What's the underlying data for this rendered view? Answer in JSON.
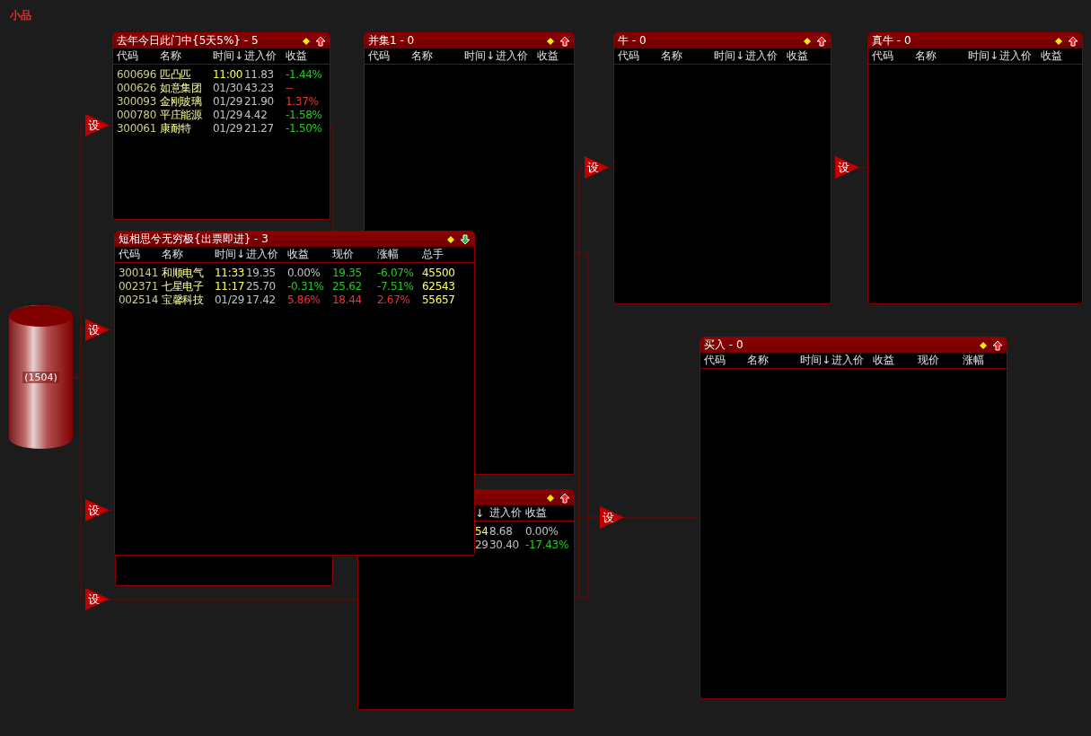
{
  "app_title": "小品",
  "source": {
    "label": "(1504)"
  },
  "set_buttons": [
    {
      "label": "设"
    },
    {
      "label": "设"
    },
    {
      "label": "设"
    },
    {
      "label": "设"
    },
    {
      "label": "设"
    },
    {
      "label": "设"
    },
    {
      "label": "设"
    }
  ],
  "windows": [
    {
      "kind": "list",
      "title": "去年今日此门中{5天5%} - 5",
      "sort_up": true,
      "columns": [
        "代码",
        "名称",
        "时间↓",
        "进入价",
        "收益"
      ],
      "rows": [
        [
          {
            "text": "600696",
            "color": "#cccc88"
          },
          {
            "text": "匹凸匹"
          },
          {
            "text": "11:00",
            "color": "#ffff55"
          },
          {
            "text": "11.83",
            "color": "#c0c0c0"
          },
          {
            "text": "-1.44%",
            "color": "#22cc22"
          }
        ],
        [
          {
            "text": "000626",
            "color": "#cccc88"
          },
          {
            "text": "如意集团"
          },
          {
            "text": "01/30",
            "color": "#c0c0c0"
          },
          {
            "text": "43.23",
            "color": "#c0c0c0"
          },
          {
            "text": "--",
            "color": "#ee3333"
          }
        ],
        [
          {
            "text": "300093",
            "color": "#cccc88"
          },
          {
            "text": "金刚玻璃"
          },
          {
            "text": "01/29",
            "color": "#c0c0c0"
          },
          {
            "text": "21.90",
            "color": "#c0c0c0"
          },
          {
            "text": "1.37%",
            "color": "#ee3333"
          }
        ],
        [
          {
            "text": "000780",
            "color": "#cccc88"
          },
          {
            "text": "平庄能源"
          },
          {
            "text": "01/29",
            "color": "#c0c0c0"
          },
          {
            "text": "4.42",
            "color": "#c0c0c0"
          },
          {
            "text": "-1.58%",
            "color": "#22cc22"
          }
        ],
        [
          {
            "text": "300061",
            "color": "#cccc88"
          },
          {
            "text": "康耐特"
          },
          {
            "text": "01/29",
            "color": "#c0c0c0"
          },
          {
            "text": "21.27",
            "color": "#c0c0c0"
          },
          {
            "text": "-1.50%",
            "color": "#22cc22"
          }
        ]
      ]
    },
    {
      "kind": "list",
      "title": "并集1 - 0",
      "sort_up": true,
      "columns": [
        "代码",
        "名称",
        "时间↓",
        "进入价",
        "收益"
      ]
    },
    {
      "kind": "list",
      "title": "牛 - 0",
      "sort_up": true,
      "columns": [
        "代码",
        "名称",
        "时间↓",
        "进入价",
        "收益"
      ]
    },
    {
      "kind": "list",
      "title": "真牛 - 0",
      "sort_up": true,
      "columns": [
        "代码",
        "名称",
        "时间↓",
        "进入价",
        "收益"
      ]
    },
    {
      "kind": "frame"
    },
    {
      "kind": "partial",
      "sort_up": true,
      "columns": [
        "↓",
        "进入价",
        "收益"
      ],
      "rows": [
        [
          {
            "text": "54",
            "color": "#ffff55"
          },
          {
            "text": "8.68",
            "color": "#c0c0c0"
          },
          {
            "text": "0.00%",
            "color": "#c0c0c0"
          }
        ],
        [
          {
            "text": "29",
            "color": "#c0c0c0"
          },
          {
            "text": "30.40",
            "color": "#c0c0c0"
          },
          {
            "text": "-17.43%",
            "color": "#22cc22"
          }
        ]
      ]
    },
    {
      "kind": "list",
      "title": "买入 - 0",
      "sort_up": true,
      "columns": [
        "代码",
        "名称",
        "时间↓",
        "进入价",
        "收益",
        "现价",
        "涨幅"
      ]
    },
    {
      "kind": "list",
      "title": "短相思兮无穷极{出票即进} - 3",
      "sort_up": false,
      "columns": [
        "代码",
        "名称",
        "时间↓",
        "进入价",
        "收益",
        "现价",
        "涨幅",
        "总手"
      ],
      "rows": [
        [
          {
            "text": "300141",
            "color": "#cccc88"
          },
          {
            "text": "和顺电气"
          },
          {
            "text": "11:33",
            "color": "#ffff55"
          },
          {
            "text": "19.35",
            "color": "#c0c0c0"
          },
          {
            "text": "0.00%",
            "color": "#c0c0c0"
          },
          {
            "text": "19.35",
            "color": "#22cc22"
          },
          {
            "text": "-6.07%",
            "color": "#22cc22"
          },
          {
            "text": "45500",
            "color": "#ffff66"
          }
        ],
        [
          {
            "text": "002371",
            "color": "#cccc88"
          },
          {
            "text": "七星电子"
          },
          {
            "text": "11:17",
            "color": "#ffff55"
          },
          {
            "text": "25.70",
            "color": "#c0c0c0"
          },
          {
            "text": "-0.31%",
            "color": "#22cc22"
          },
          {
            "text": "25.62",
            "color": "#22cc22"
          },
          {
            "text": "-7.51%",
            "color": "#22cc22"
          },
          {
            "text": "62543",
            "color": "#ffff66"
          }
        ],
        [
          {
            "text": "002514",
            "color": "#cccc88"
          },
          {
            "text": "宝馨科技"
          },
          {
            "text": "01/29",
            "color": "#c0c0c0"
          },
          {
            "text": "17.42",
            "color": "#c0c0c0"
          },
          {
            "text": "5.86%",
            "color": "#ee3333"
          },
          {
            "text": "18.44",
            "color": "#ee3333"
          },
          {
            "text": "2.67%",
            "color": "#ee3333"
          },
          {
            "text": "55657",
            "color": "#ffff66"
          }
        ]
      ]
    }
  ]
}
